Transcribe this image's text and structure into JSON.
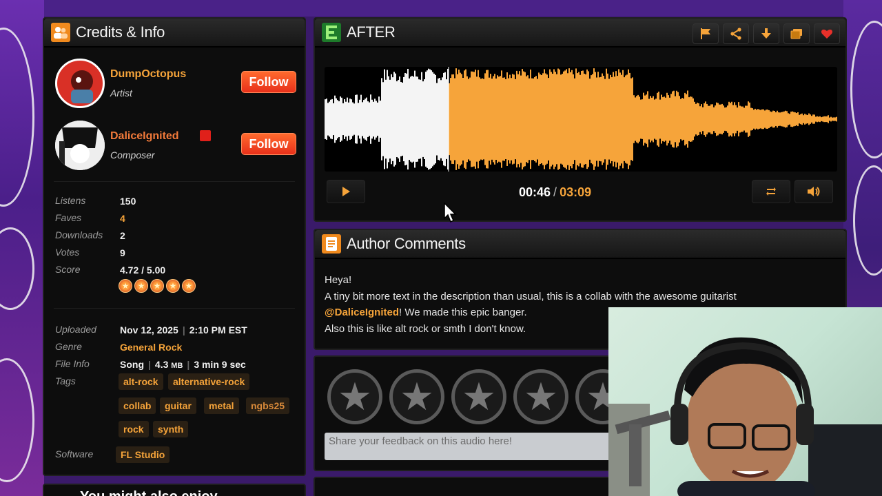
{
  "credits": {
    "title": "Credits & Info",
    "people": [
      {
        "name": "DumpOctopus",
        "role": "Artist",
        "follow_label": "Follow"
      },
      {
        "name": "DaliceIgnited",
        "role": "Composer",
        "follow_label": "Follow"
      }
    ],
    "stats": [
      {
        "label": "Listens",
        "value": "150"
      },
      {
        "label": "Faves",
        "value": "4"
      },
      {
        "label": "Downloads",
        "value": "2"
      },
      {
        "label": "Votes",
        "value": "9"
      },
      {
        "label": "Score",
        "value": "4.72 / 5.00"
      }
    ],
    "score_stars": 5,
    "info": {
      "uploaded_label": "Uploaded",
      "uploaded_value": "Nov 12, 2025",
      "uploaded_time": "2:10 PM EST",
      "genre_label": "Genre",
      "genre_value": "General Rock",
      "fileinfo_label": "File Info",
      "fileinfo_type": "Song",
      "fileinfo_size": "4.3",
      "fileinfo_unit": "MB",
      "fileinfo_length": "3 min 9 sec",
      "tags_label": "Tags",
      "tags": [
        "alt-rock",
        "alternative-rock",
        "collab",
        "guitar",
        "metal",
        "ngbs25",
        "rock",
        "synth"
      ],
      "software_label": "Software",
      "software_value": "FL Studio"
    }
  },
  "player": {
    "title": "AFTER",
    "header_icons": [
      "flag-icon",
      "share-icon",
      "download-icon",
      "playlist-icon",
      "favorite-icon"
    ],
    "current_time": "00:46",
    "separator": "/",
    "total_time": "03:09",
    "played_fraction": 0.24
  },
  "comments": {
    "title": "Author Comments",
    "line1": "Heya!",
    "line2": "A tiny bit more text in the description than usual, this is a collab with the awesome guitarist",
    "mention": "@DaliceIgnited",
    "line3_rest": "! We made this epic banger.",
    "line4": "Also this is like alt rock or smth I don't know."
  },
  "review": {
    "feedback_placeholder": "Share your feedback on this audio here!"
  },
  "also": {
    "title": "You might also enjoy"
  },
  "colors": {
    "accent": "#f6a43a",
    "follow": "#e8301a",
    "panel": "#0d0d0d",
    "background": "#3a1a6a"
  }
}
